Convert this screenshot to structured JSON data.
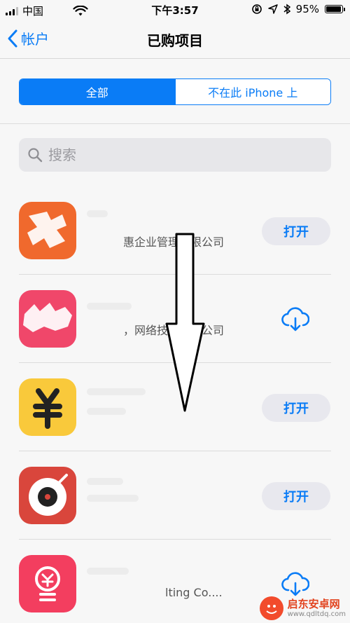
{
  "status_bar": {
    "carrier": "中国",
    "time": "下午3:57",
    "battery": "95%",
    "battery_level": 0.95
  },
  "nav": {
    "back_label": "帐户",
    "title": "已购项目"
  },
  "segmented": {
    "tab_all": "全部",
    "tab_not_on_device": "不在此 iPhone 上"
  },
  "search": {
    "placeholder": "搜索"
  },
  "apps": [
    {
      "subtitle": "惠企业管理有限公司",
      "action": "打开",
      "icon_color": "#f0692d"
    },
    {
      "subtitle": "，网络技术有限公司",
      "action": "",
      "icon_color": "#f0476a"
    },
    {
      "subtitle": "",
      "action": "打开",
      "icon_color": "#f9c93b"
    },
    {
      "subtitle": "",
      "action": "打开",
      "icon_color": "#d9463c"
    },
    {
      "subtitle": "lting Co....",
      "action": "",
      "icon_color": "#f33e5f"
    }
  ],
  "colors": {
    "accent": "#0a7cf6"
  },
  "watermark": {
    "name": "启东安卓网",
    "url": "www.qdltdq.com"
  }
}
